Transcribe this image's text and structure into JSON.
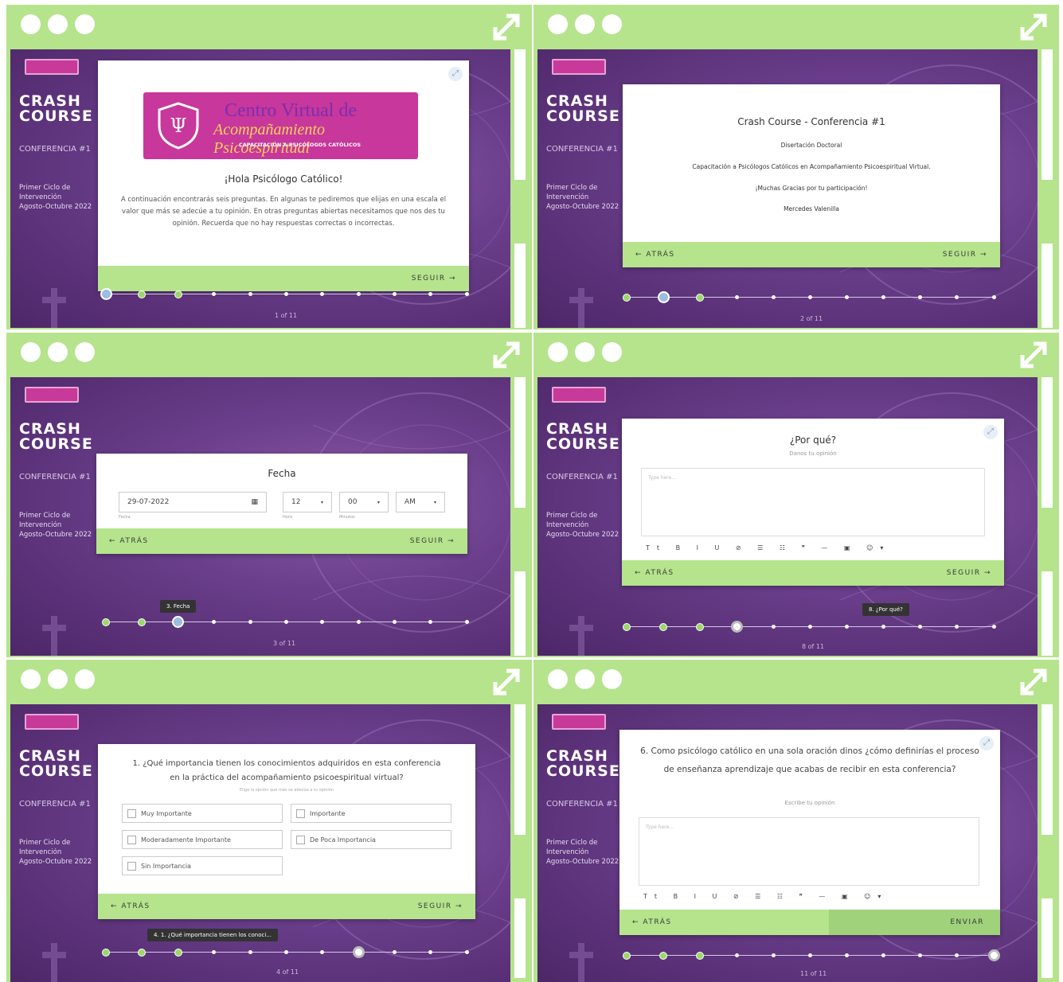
{
  "colors": {
    "panel_bg": "#b5e48c",
    "screen_purple": "#6b3f8c",
    "bar_green": "#b5e48c"
  },
  "common": {
    "crash": "CRASH",
    "course": "COURSE",
    "conference": "CONFERENCIA #1",
    "cycle_line1": "Primer Ciclo de",
    "cycle_line2": "Intervención",
    "cycle_line3": "Agosto-Octubre 2022",
    "back": "← ATRÁS",
    "next": "SEGUIR →",
    "send": "ENVIAR",
    "icons": [
      "window-dot-icon",
      "expand-icon",
      "logo-icon",
      "cross-icon",
      "psi-icon",
      "minimize-icon"
    ]
  },
  "panels": [
    {
      "id": "welcome",
      "logo_line1": "Centro Virtual de",
      "logo_line2": "Acompañamiento Psicoespiritual",
      "logo_line3": "CAPACITACIÓN A PSICÓLOGOS CATÓLICOS",
      "greeting": "¡Hola Psicólogo Católico!",
      "body": "A continuación encontrarás seis preguntas. En algunas te pediremos que elijas en una escala el valor que más se adecúe a tu opinión. En otras preguntas abiertas necesitamos que nos des tu opinión. Recuerda que no hay respuestas correctas o incorrectas.",
      "progress_label": "1 of 11"
    },
    {
      "id": "intro",
      "title": "Crash Course - Conferencia #1",
      "line1": "Disertación Doctoral",
      "line2": "Capacitación a Psicólogos Católicos en Acompañamiento Psicoespiritual Virtual.",
      "line3": "¡Muchas Gracias por tu participación!",
      "line4": "Mercedes Valenilla",
      "progress_label": "2 of 11"
    },
    {
      "id": "date",
      "title": "Fecha",
      "date_value": "29-07-2022",
      "date_label": "Fecha",
      "hour_value": "12",
      "hour_label": "Hora",
      "min_value": "00",
      "min_label": "Minutos",
      "ampm_value": "AM",
      "tooltip": "3. Fecha",
      "progress_label": "3 of 11"
    },
    {
      "id": "why",
      "title": "¿Por qué?",
      "subtitle": "Danos tu opinión",
      "placeholder": "Type here...",
      "toolbar": "Tt B I U ⊘ ☰ ☷ ❞ — ▣ ☺▾",
      "tooltip": "8. ¿Por qué?",
      "progress_label": "8 of 11"
    },
    {
      "id": "importance",
      "question": "1. ¿Qué importancia tienen los conocimientos adquiridos en esta conferencia en la práctica del acompañamiento psicoespiritual virtual?",
      "hint": "Elige la opción que más se adecúe a tu opinión",
      "options": [
        "Muy Importante",
        "Importante",
        "Moderadamente Importante",
        "De Poca Importancia",
        "Sin Importancia"
      ],
      "tooltip": "4. 1. ¿Qué importancia tienen los conoci...",
      "progress_label": "4 of 11"
    },
    {
      "id": "final",
      "question": "6. Como psicólogo católico en una sola oración dinos ¿cómo definirías el proceso de enseñanza aprendizaje que acabas de recibir en esta conferencia?",
      "subtitle": "Escribe tu opinión",
      "placeholder": "Type here...",
      "toolbar": "Tt B I U ⊘ ☰ ☷ ❞ — ▣ ☺▾",
      "progress_label": "11 of 11"
    }
  ]
}
